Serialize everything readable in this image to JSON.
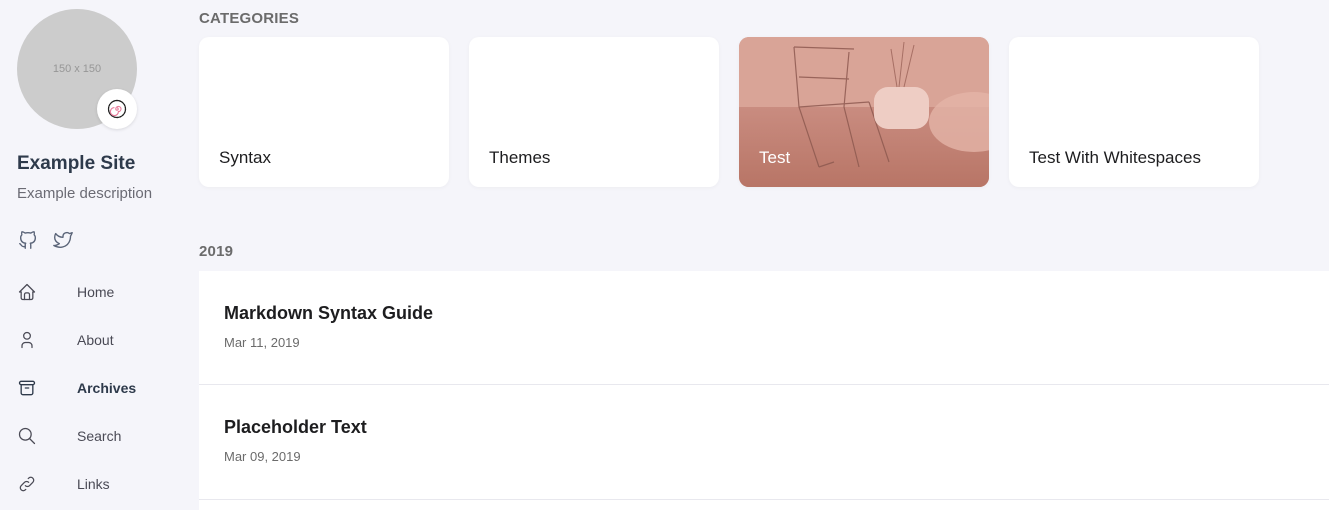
{
  "sidebar": {
    "avatar_text": "150 x 150",
    "emoji": "🍥",
    "site_name": "Example Site",
    "site_description": "Example description",
    "social": [
      {
        "icon": "github-icon"
      },
      {
        "icon": "twitter-icon"
      }
    ],
    "menu": [
      {
        "label": "Home",
        "icon": "home-icon",
        "active": false
      },
      {
        "label": "About",
        "icon": "user-icon",
        "active": false
      },
      {
        "label": "Archives",
        "icon": "archive-icon",
        "active": true
      },
      {
        "label": "Search",
        "icon": "search-icon",
        "active": false
      },
      {
        "label": "Links",
        "icon": "link-icon",
        "active": false
      }
    ]
  },
  "main": {
    "categories_heading": "CATEGORIES",
    "categories": [
      {
        "label": "Syntax"
      },
      {
        "label": "Themes"
      },
      {
        "label": "Test"
      },
      {
        "label": "Test With Whitespaces"
      }
    ],
    "year_heading": "2019",
    "archives": [
      {
        "title": "Markdown Syntax Guide",
        "date": "Mar 11, 2019"
      },
      {
        "title": "Placeholder Text",
        "date": "Mar 09, 2019"
      }
    ]
  },
  "colors": {
    "background": "#f5f5fa",
    "card": "#ffffff",
    "accent_text": "#2e3a4b",
    "test_card_tint": "#d49a8e"
  }
}
